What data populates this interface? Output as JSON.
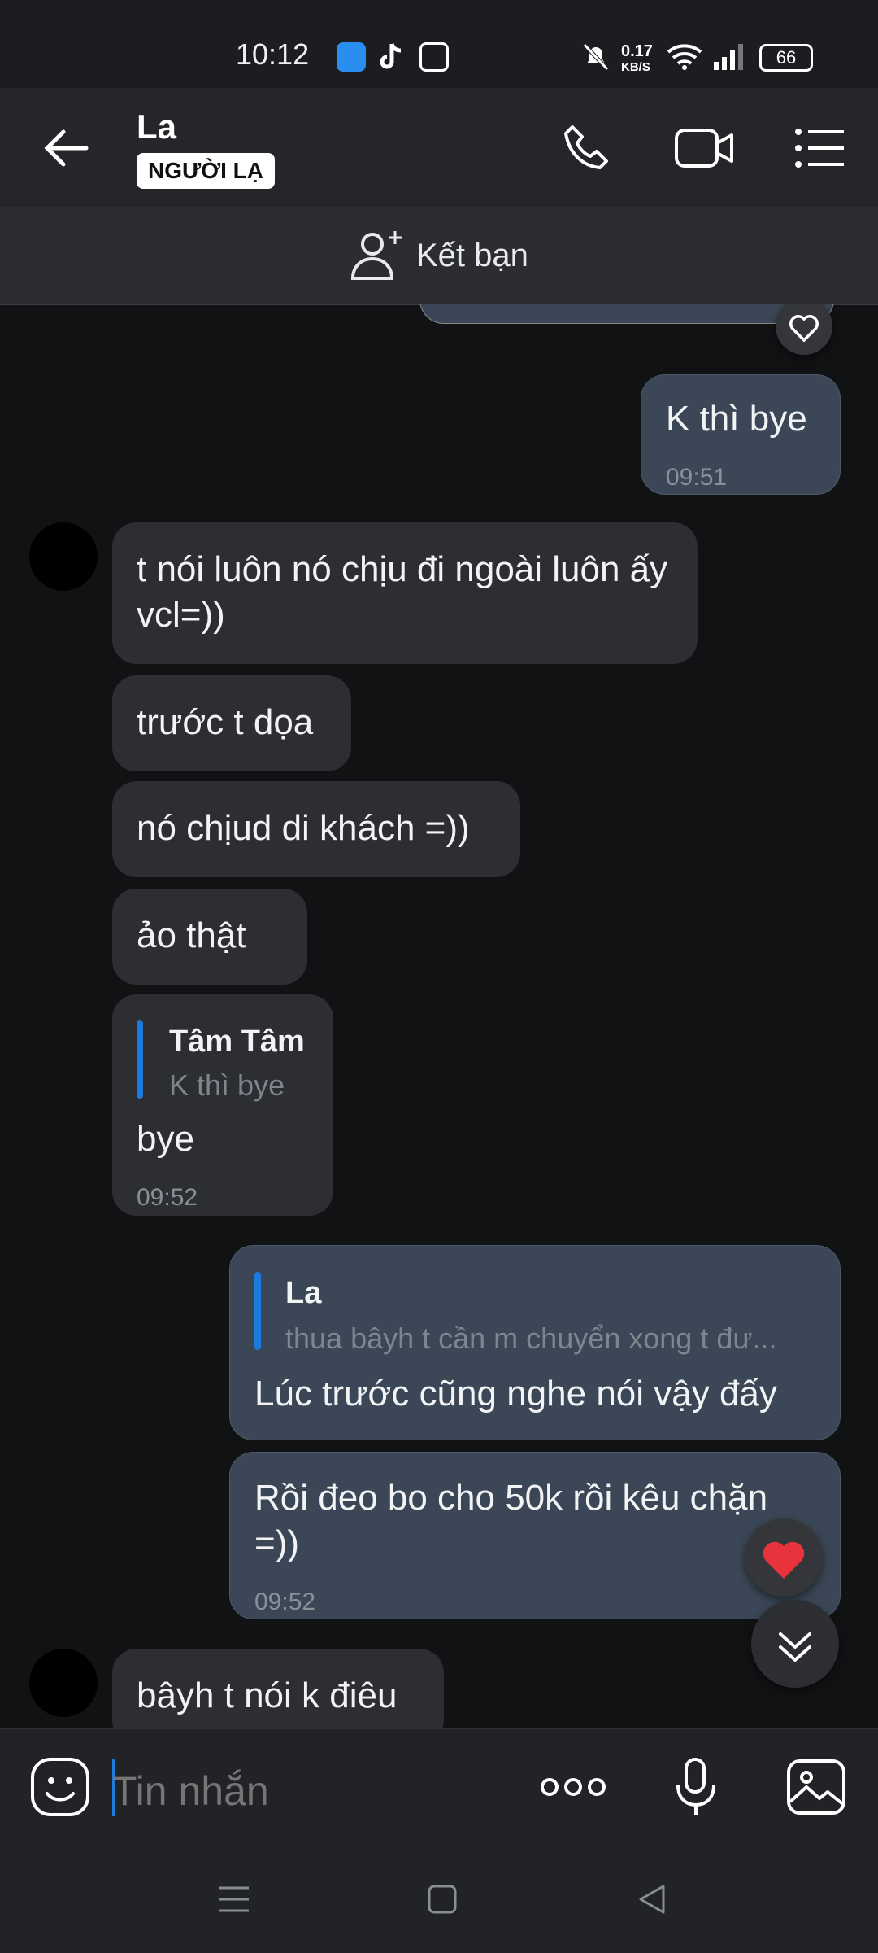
{
  "status_bar": {
    "time": "10:12",
    "net_speed_value": "0.17",
    "net_speed_unit": "KB/S",
    "battery": "66"
  },
  "header": {
    "contact_name": "La",
    "stranger_badge": "NGƯỜI LẠ"
  },
  "add_friend": {
    "label": "Kết bạn"
  },
  "messages": [
    {
      "side": "out",
      "text": "K thì bye",
      "time": "09:51"
    },
    {
      "side": "in",
      "text": "t nói luôn nó chịu đi ngoài luôn ấy vcl=))"
    },
    {
      "side": "in",
      "text": "trước t dọa"
    },
    {
      "side": "in",
      "text": "nó chịud di khách =))"
    },
    {
      "side": "in",
      "text": "ảo thật"
    },
    {
      "side": "in",
      "reply_name": "Tâm Tâm",
      "reply_text": "K thì bye",
      "text": "bye",
      "time": "09:52"
    },
    {
      "side": "out",
      "reply_name": "La",
      "reply_text": "thua bâyh t cần m chuyển xong t đư...",
      "text": "Lúc trước cũng nghe nói vậy đấy"
    },
    {
      "side": "out",
      "text": "Rồi đeo bo cho 50k rồi kêu chặn =))",
      "time": "09:52"
    },
    {
      "side": "in",
      "text": "bâyh t nói k điêu"
    }
  ],
  "composer": {
    "placeholder": "Tin nhắn"
  },
  "colors": {
    "accent": "#1f7ae0",
    "heart": "#e8323c",
    "out_bubble": "#3b4756",
    "in_bubble": "#2d2e31"
  }
}
